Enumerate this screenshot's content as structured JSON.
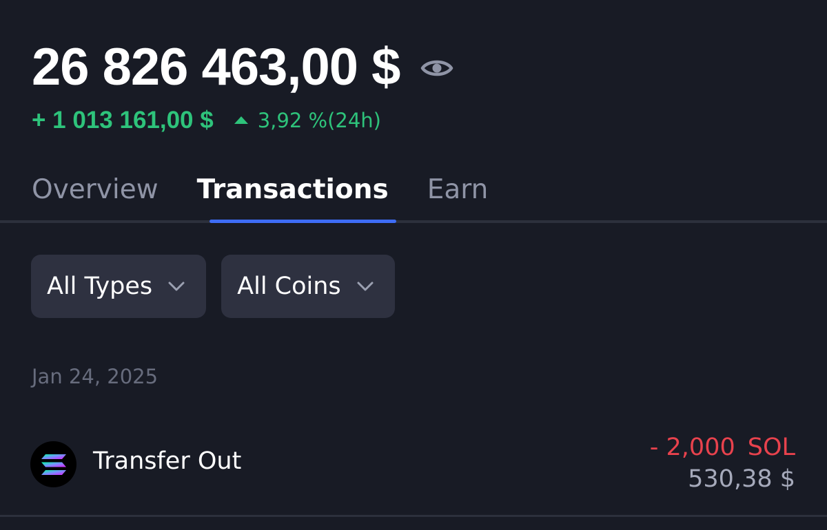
{
  "portfolio": {
    "balance": "26 826 463,00 $",
    "visibility_icon": "eye-icon",
    "change_amount": "+ 1 013 161,00 $",
    "change_direction_icon": "caret-up-icon",
    "change_percent": "3,92 %(24h)"
  },
  "tabs": [
    {
      "label": "Overview",
      "active": false
    },
    {
      "label": "Transactions",
      "active": true
    },
    {
      "label": "Earn",
      "active": false
    }
  ],
  "filters": {
    "types": {
      "label": "All Types",
      "icon": "chevron-down-icon"
    },
    "coins": {
      "label": "All Coins",
      "icon": "chevron-down-icon"
    }
  },
  "transactions": {
    "groups": [
      {
        "date": "Jan 24, 2025",
        "items": [
          {
            "type": "Transfer Out",
            "coin_icon": "solana-icon",
            "amount": "- 2,000",
            "symbol": "SOL",
            "fiat_value": "530,38 $"
          }
        ]
      }
    ]
  },
  "colors": {
    "background": "#181b25",
    "positive": "#2ec37b",
    "negative": "#e8424d",
    "accent": "#3e6df6",
    "muted_text": "#8f94a6",
    "chip_background": "#2e3140"
  }
}
